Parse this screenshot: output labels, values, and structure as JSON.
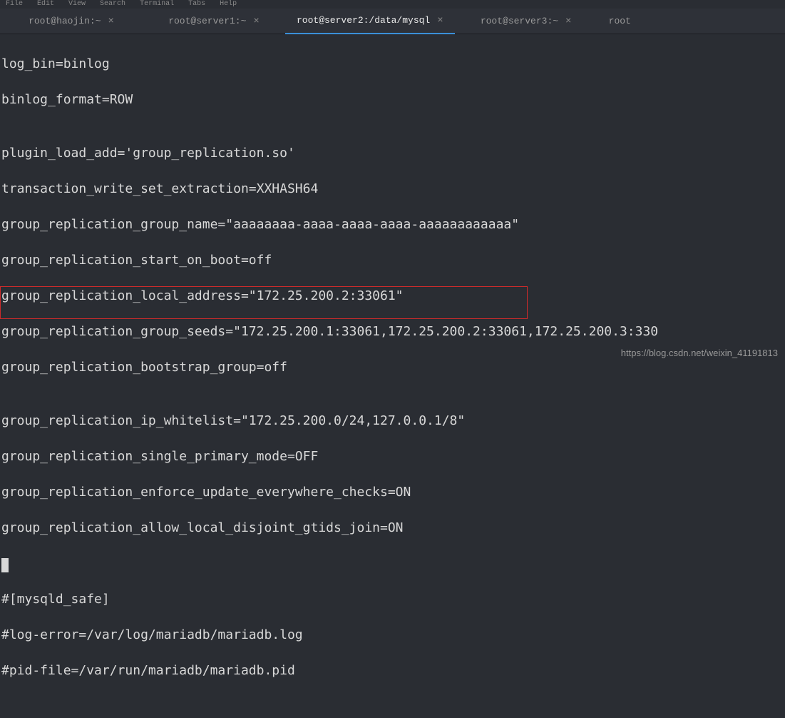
{
  "menubar": {
    "items": [
      "File",
      "Edit",
      "View",
      "Search",
      "Terminal",
      "Tabs",
      "Help"
    ]
  },
  "tabs": [
    {
      "label": "root@haojin:~",
      "active": false
    },
    {
      "label": "root@server1:~",
      "active": false
    },
    {
      "label": "root@server2:/data/mysql",
      "active": true
    },
    {
      "label": "root@server3:~",
      "active": false
    },
    {
      "label": "root",
      "active": false
    }
  ],
  "terminal": {
    "lines": [
      "log_bin=binlog",
      "binlog_format=ROW",
      "",
      "plugin_load_add='group_replication.so'",
      "transaction_write_set_extraction=XXHASH64",
      "group_replication_group_name=\"aaaaaaaa-aaaa-aaaa-aaaa-aaaaaaaaaaaa\"",
      "group_replication_start_on_boot=off",
      "group_replication_local_address=\"172.25.200.2:33061\"",
      "group_replication_group_seeds=\"172.25.200.1:33061,172.25.200.2:33061,172.25.200.3:330",
      "group_replication_bootstrap_group=off",
      "",
      "group_replication_ip_whitelist=\"172.25.200.0/24,127.0.0.1/8\"",
      "group_replication_single_primary_mode=OFF",
      "group_replication_enforce_update_everywhere_checks=ON",
      "group_replication_allow_local_disjoint_gtids_join=ON",
      "",
      "#[mysqld_safe]",
      "#log-error=/var/log/mariadb/mariadb.log",
      "#pid-file=/var/run/mariadb/mariadb.pid"
    ]
  },
  "watermark": "https://blog.csdn.net/weixin_41191813",
  "close_symbol": "×"
}
